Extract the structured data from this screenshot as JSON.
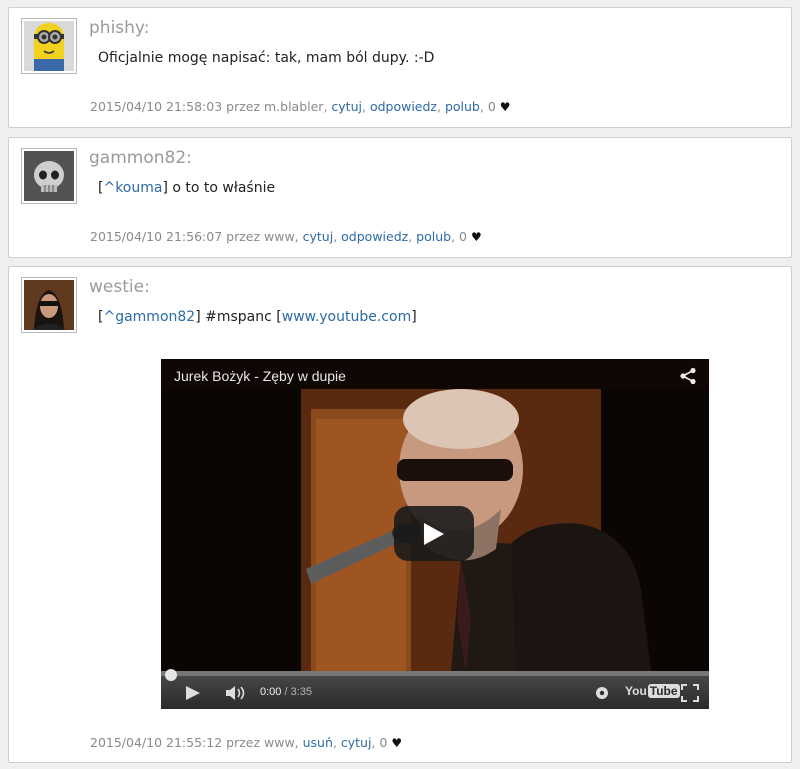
{
  "posts": [
    {
      "author": "phishy:",
      "content": "Oficjalnie mogę napisać: tak, mam ból dupy. :-D",
      "meta_prefix": "2015/04/10 21:58:03 przez m.blabler, ",
      "actions": [
        "cytuj",
        "odpowiedz",
        "polub"
      ],
      "likes_prefix": ", 0"
    },
    {
      "author": "gammon82:",
      "mention": "^kouma",
      "content_text": " o to to właśnie",
      "meta_prefix": "2015/04/10 21:56:07 przez www, ",
      "actions": [
        "cytuj",
        "odpowiedz",
        "polub"
      ],
      "likes_prefix": ", 0"
    },
    {
      "author": "westie:",
      "mention": "^gammon82",
      "hashtag": "#mspanc",
      "link": "www.youtube.com",
      "meta_prefix": "2015/04/10 21:55:12 przez www, ",
      "actions": [
        "usuń",
        "cytuj"
      ],
      "likes_prefix": ", 0"
    }
  ],
  "video": {
    "title": "Jurek Bożyk - Zęby w dupie",
    "current_time": "0:00",
    "duration": "/ 3:35",
    "logo_you": "You",
    "logo_tube": "Tube",
    "progress": 0
  },
  "icons": {
    "heart": "heart-icon",
    "share": "share-icon",
    "play": "play-icon",
    "volume": "volume-icon",
    "settings": "gear-icon",
    "fullscreen": "fullscreen-icon"
  },
  "colors": {
    "link": "#2b6aa6",
    "author": "#9a9a9a",
    "meta": "#8a8a8a",
    "background": "#efefef"
  }
}
